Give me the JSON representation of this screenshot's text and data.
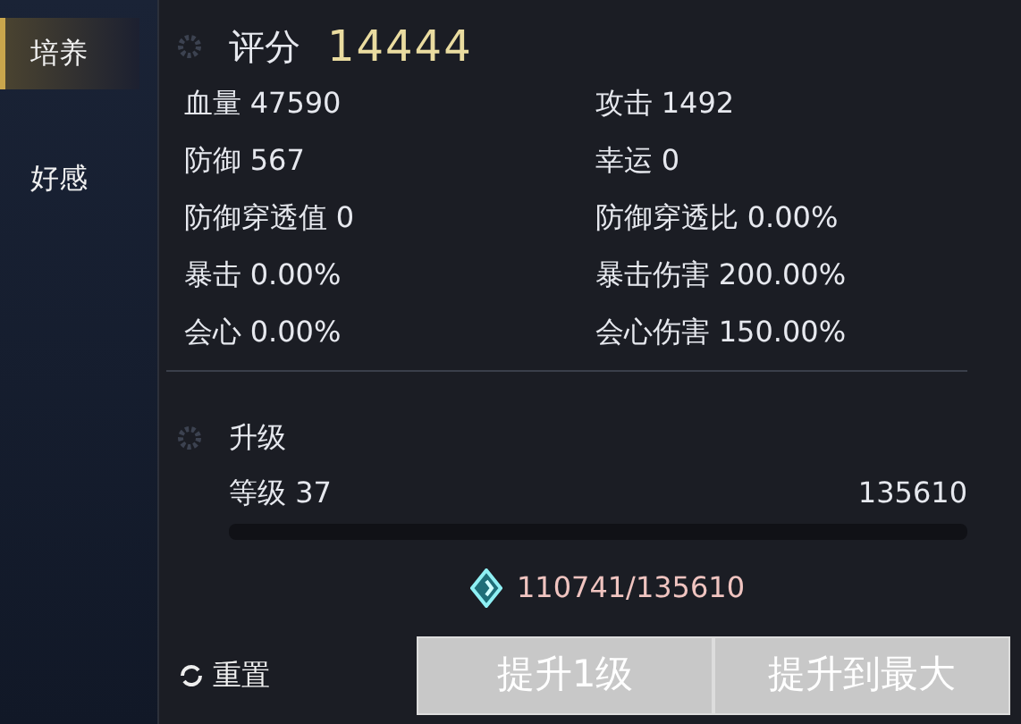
{
  "sidebar": {
    "tabs": [
      {
        "label": "培养",
        "selected": true
      },
      {
        "label": "好感",
        "selected": false
      }
    ]
  },
  "score": {
    "label": "评分",
    "value": "14444"
  },
  "stats": [
    {
      "text": "血量 47590"
    },
    {
      "text": "攻击 1492"
    },
    {
      "text": "防御 567"
    },
    {
      "text": "幸运 0"
    },
    {
      "text": "防御穿透值 0"
    },
    {
      "text": "防御穿透比 0.00%"
    },
    {
      "text": "暴击 0.00%"
    },
    {
      "text": "暴击伤害 200.00%"
    },
    {
      "text": "会心 0.00%"
    },
    {
      "text": "会心伤害 150.00%"
    }
  ],
  "upgrade": {
    "title": "升级",
    "level_label": "等级 37",
    "max_exp": "135610",
    "cost": "110741/135610"
  },
  "reset": {
    "label": "重置"
  },
  "buttons": [
    {
      "label": "提升1级"
    },
    {
      "label": "提升到最大"
    }
  ]
}
